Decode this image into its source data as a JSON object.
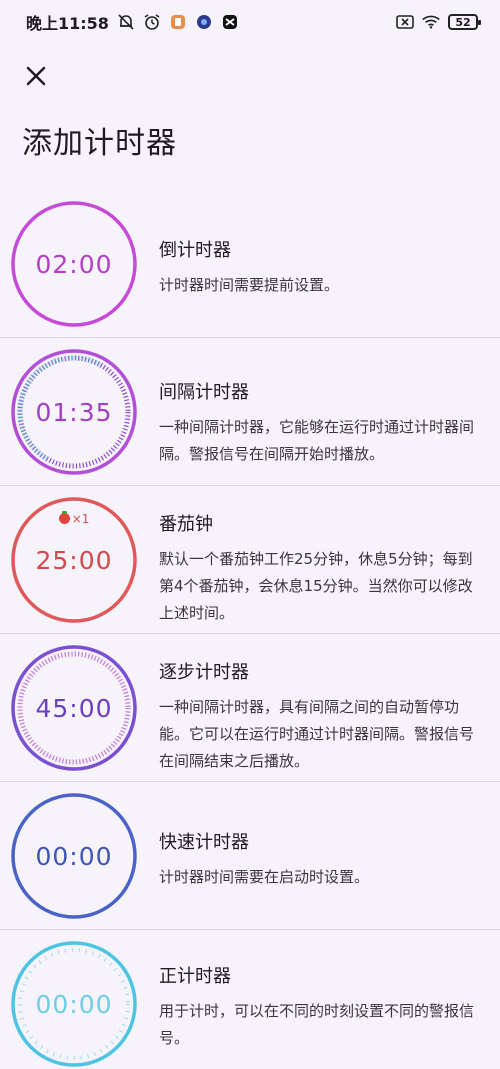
{
  "status_bar": {
    "time": "晚上11:58",
    "battery": "52",
    "icons": [
      "mute-bell-icon",
      "alarm-clock-icon",
      "app-notification-icon",
      "app-notification-icon",
      "app-notification-icon",
      "sim-x-icon",
      "wifi-icon",
      "battery-icon"
    ]
  },
  "header": {
    "close_icon": "close-icon",
    "title": "添加计时器"
  },
  "colors": {
    "countdown": "#c64ad8",
    "interval": "#b24fd6",
    "tomato": "#e0585a",
    "stepwise": "#7b4fd1",
    "quick": "#4b63c9",
    "stopwatch": "#4cc4e2"
  },
  "timers": [
    {
      "time": "02:00",
      "title": "倒计时器",
      "desc": "计时器时间需要提前设置。"
    },
    {
      "time": "01:35",
      "title": "间隔计时器",
      "desc": "一种间隔计时器，它能够在运行时通过计时器间隔。警报信号在间隔开始时播放。"
    },
    {
      "time": "25:00",
      "title": "番茄钟",
      "desc": "默认一个番茄钟工作25分钟，休息5分钟；每到第4个番茄钟，会休息15分钟。当然你可以修改上述时间。",
      "badge": "×1"
    },
    {
      "time": "45:00",
      "title": "逐步计时器",
      "desc": "一种间隔计时器，具有间隔之间的自动暂停功能。它可以在运行时通过计时器间隔。警报信号在间隔结束之后播放。"
    },
    {
      "time": "00:00",
      "title": "快速计时器",
      "desc": "计时器时间需要在启动时设置。"
    },
    {
      "time": "00:00",
      "title": "正计时器",
      "desc": "用于计时，可以在不同的时刻设置不同的警报信号。"
    }
  ]
}
